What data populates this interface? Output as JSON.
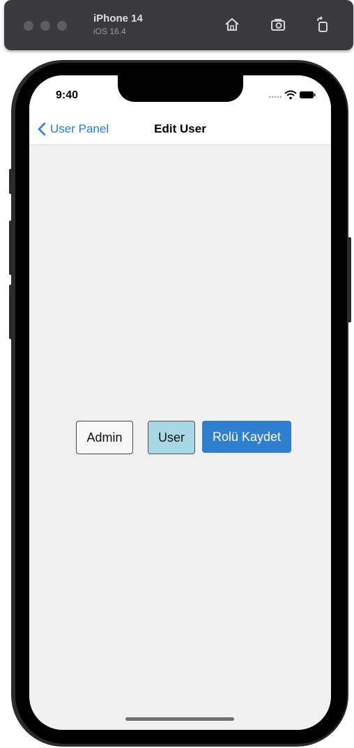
{
  "simulator": {
    "device_name": "iPhone 14",
    "os_version": "iOS 16.4",
    "icons": [
      "home-icon",
      "screenshot-icon",
      "rotate-icon"
    ]
  },
  "status_bar": {
    "time": "9:40",
    "icons": [
      "signal-dots-icon",
      "wifi-icon",
      "battery-icon"
    ]
  },
  "nav": {
    "back_label": "User Panel",
    "title": "Edit User",
    "accent": "#1d7cf2"
  },
  "roles": {
    "admin_label": "Admin",
    "user_label": "User",
    "save_label": "Rolü Kaydet",
    "selected": "User",
    "selected_color": "#a8d8e3",
    "save_color": "#2f7fd1"
  }
}
